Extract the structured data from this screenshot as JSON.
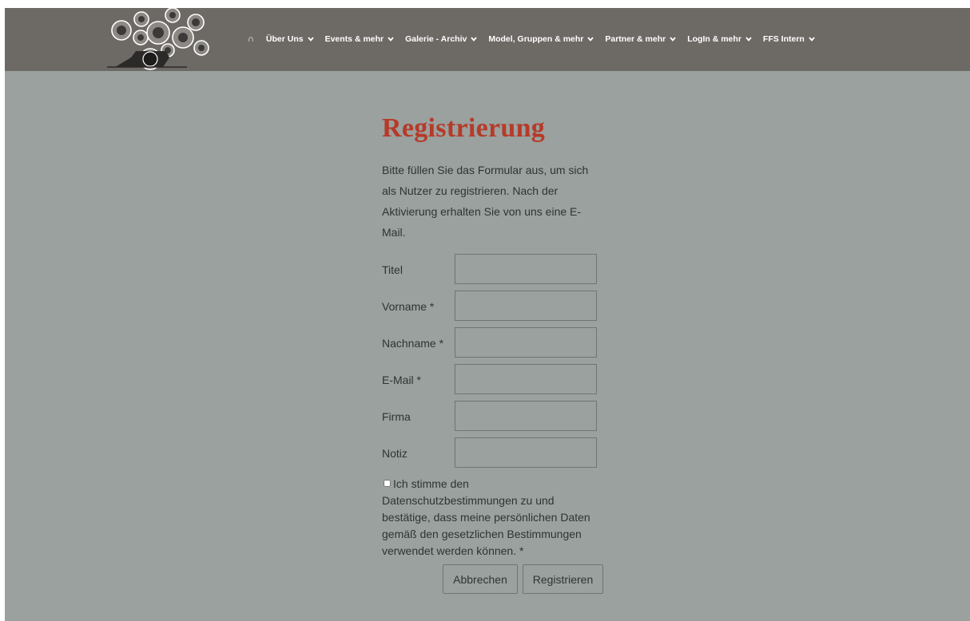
{
  "nav": {
    "home_icon": "home-icon",
    "items": [
      {
        "label": "Über Uns"
      },
      {
        "label": "Events & mehr"
      },
      {
        "label": "Galerie - Archiv"
      },
      {
        "label": "Model, Gruppen & mehr"
      },
      {
        "label": "Partner & mehr"
      },
      {
        "label": "LogIn & mehr"
      },
      {
        "label": "FFS Intern"
      }
    ]
  },
  "form": {
    "title": "Registrierung",
    "intro": "Bitte füllen Sie das Formular aus, um sich als Nutzer zu registrieren. Nach der Aktivierung erhalten Sie von uns eine E-Mail.",
    "fields": {
      "titel": {
        "label": "Titel",
        "value": ""
      },
      "vorname": {
        "label": "Vorname *",
        "value": ""
      },
      "nachname": {
        "label": "Nachname *",
        "value": ""
      },
      "email": {
        "label": "E-Mail *",
        "value": ""
      },
      "firma": {
        "label": "Firma",
        "value": ""
      },
      "notiz": {
        "label": "Notiz",
        "value": ""
      }
    },
    "consent": "Ich stimme den Datenschutzbestimmungen zu und bestätige, dass meine persönlichen Daten gemäß den gesetzlichen Bestimmungen verwendet werden können. *",
    "cancel_label": "Abbrechen",
    "submit_label": "Registrieren"
  },
  "colors": {
    "navbar": "#6d6a66",
    "background": "#9aa19f",
    "title": "#b63a28"
  }
}
